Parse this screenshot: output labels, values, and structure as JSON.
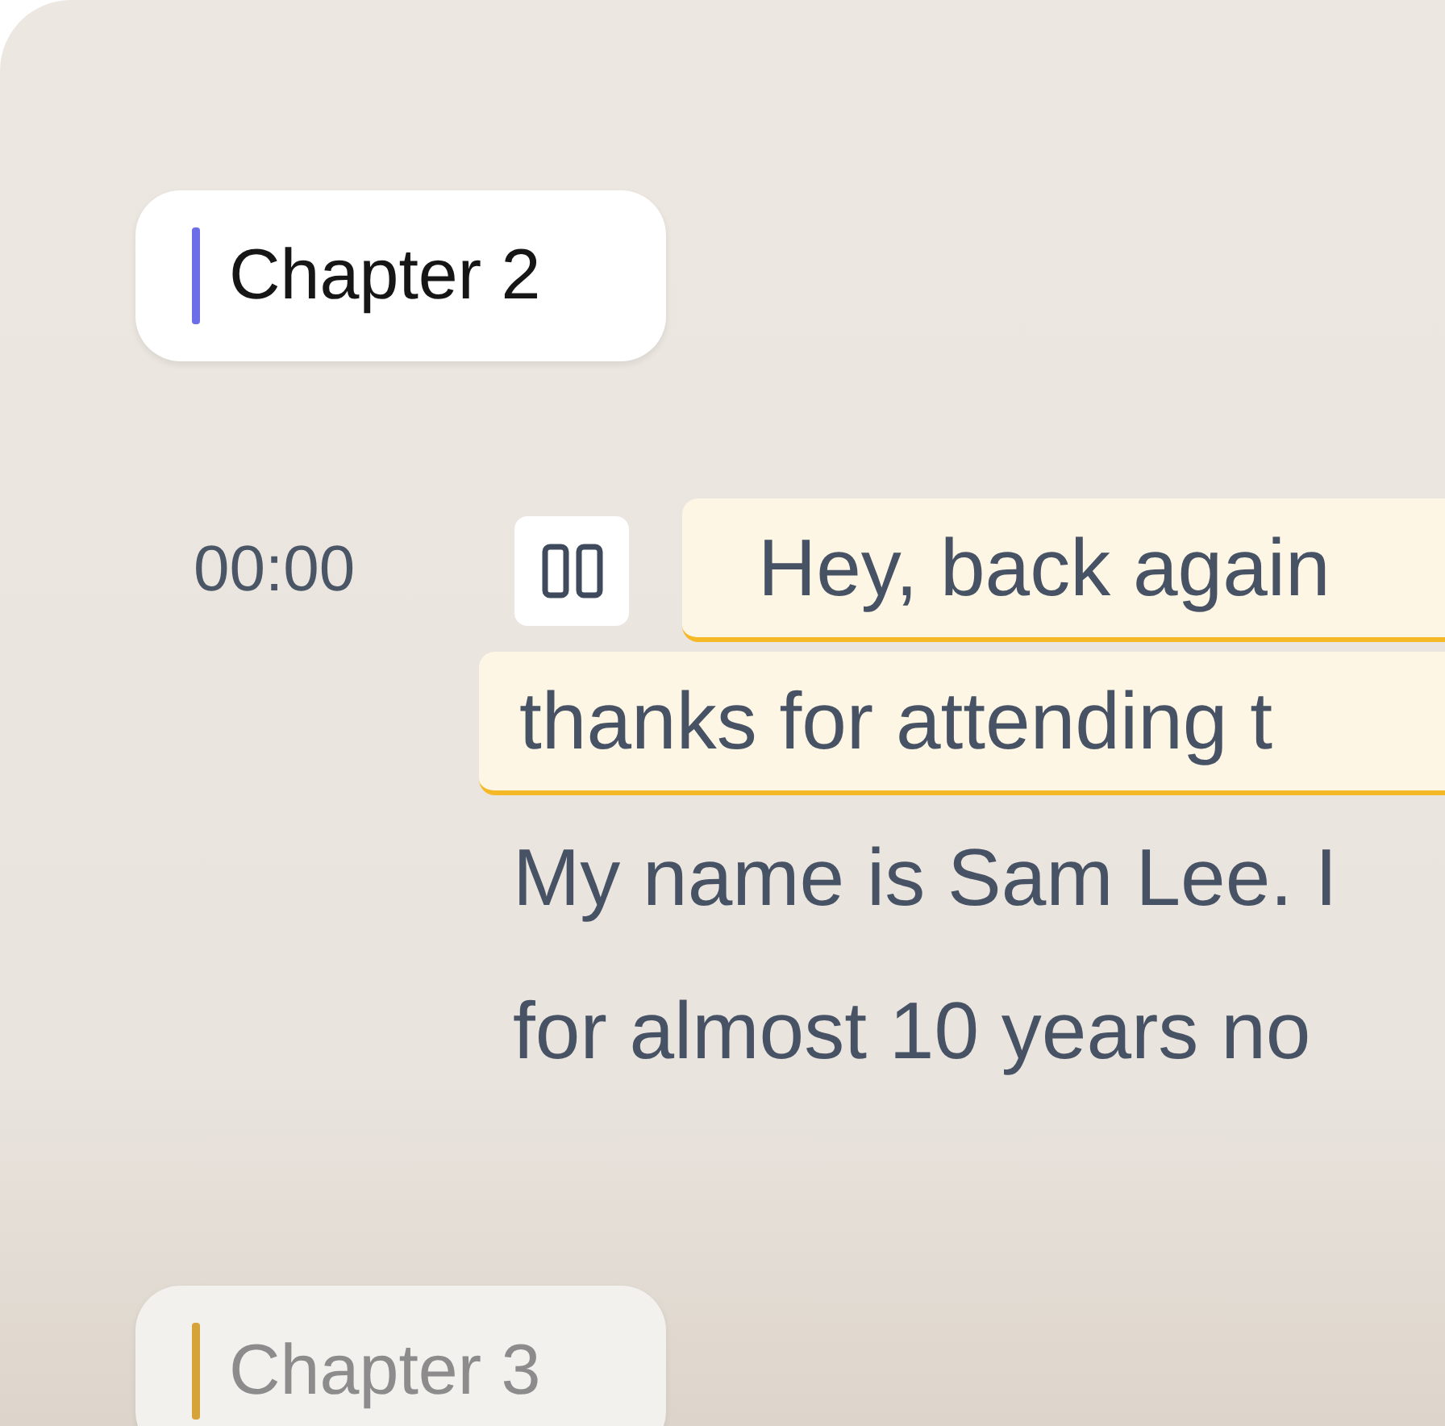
{
  "sections": [
    {
      "kind": "chapter",
      "title": "Chapter 2",
      "color": "#6b6ee8",
      "active": true
    },
    {
      "kind": "transcript",
      "time": "00:00",
      "playing": true,
      "lines": [
        {
          "text": "Hey, back again",
          "highlighted": true
        },
        {
          "text": "thanks for attending t",
          "highlighted": true
        },
        {
          "text": "My name is Sam Lee. I",
          "highlighted": false
        },
        {
          "text": "for almost 10 years no",
          "highlighted": false
        }
      ]
    },
    {
      "kind": "chapter",
      "title": "Chapter 3",
      "color": "#d6a23a",
      "active": false
    }
  ]
}
